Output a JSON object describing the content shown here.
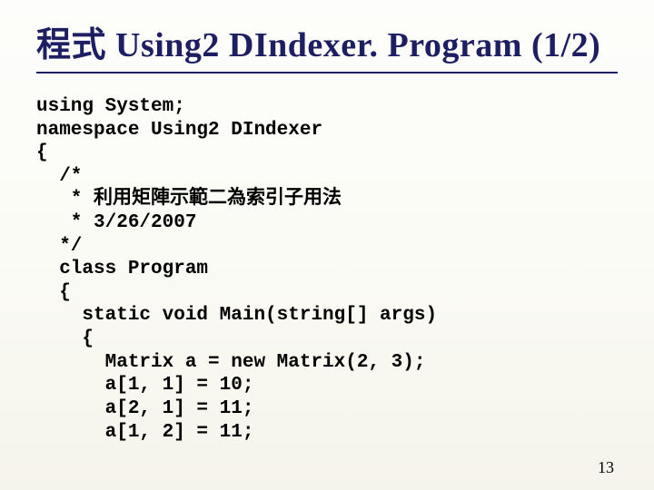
{
  "title": "程式 Using2 DIndexer. Program (1/2)",
  "code": "using System;\nnamespace Using2 DIndexer\n{\n  /*\n   * 利用矩陣示範二為索引子用法\n   * 3/26/2007\n  */\n  class Program\n  {\n    static void Main(string[] args)\n    {\n      Matrix a = new Matrix(2, 3);\n      a[1, 1] = 10;\n      a[2, 1] = 11;\n      a[1, 2] = 11;",
  "pageNumber": "13"
}
